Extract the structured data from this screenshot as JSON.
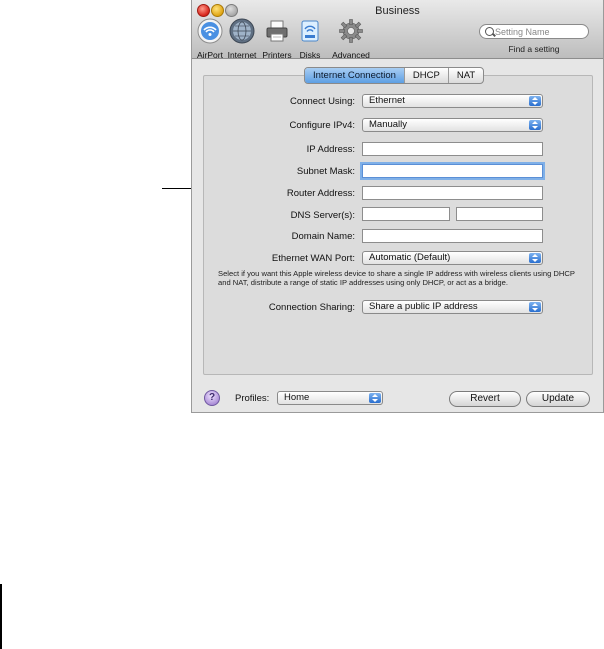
{
  "window": {
    "title": "Business"
  },
  "toolbar": {
    "items": [
      {
        "label": "AirPort",
        "icon": "airport-icon"
      },
      {
        "label": "Internet",
        "icon": "internet-icon"
      },
      {
        "label": "Printers",
        "icon": "printer-icon"
      },
      {
        "label": "Disks",
        "icon": "disk-icon"
      },
      {
        "label": "Advanced",
        "icon": "gear-icon"
      }
    ],
    "search_placeholder": "Setting Name",
    "find_label": "Find a setting"
  },
  "tabs": [
    {
      "label": "Internet Connection",
      "selected": true
    },
    {
      "label": "DHCP",
      "selected": false
    },
    {
      "label": "NAT",
      "selected": false
    }
  ],
  "form": {
    "connect_using": {
      "label": "Connect Using:",
      "value": "Ethernet"
    },
    "configure_ipv4": {
      "label": "Configure IPv4:",
      "value": "Manually"
    },
    "ip_address": {
      "label": "IP Address:",
      "value": ""
    },
    "subnet_mask": {
      "label": "Subnet Mask:",
      "value": ""
    },
    "router_address": {
      "label": "Router Address:",
      "value": ""
    },
    "dns_servers": {
      "label": "DNS Server(s):",
      "value1": "",
      "value2": ""
    },
    "domain_name": {
      "label": "Domain Name:",
      "value": ""
    },
    "ethernet_wan_port": {
      "label": "Ethernet WAN Port:",
      "value": "Automatic (Default)"
    },
    "description": "Select if you want this Apple wireless device to share a single IP address with wireless clients using DHCP and NAT, distribute a range of static IP addresses using only DHCP, or act as a bridge.",
    "connection_sharing": {
      "label": "Connection Sharing:",
      "value": "Share a public IP address"
    }
  },
  "footer": {
    "help": "?",
    "profiles_label": "Profiles:",
    "profiles_value": "Home",
    "revert_label": "Revert",
    "update_label": "Update"
  },
  "colors": {
    "accent": "#5e9fe4",
    "window_bg": "#e6e6e6",
    "panel_bg": "#dcdcdc"
  }
}
